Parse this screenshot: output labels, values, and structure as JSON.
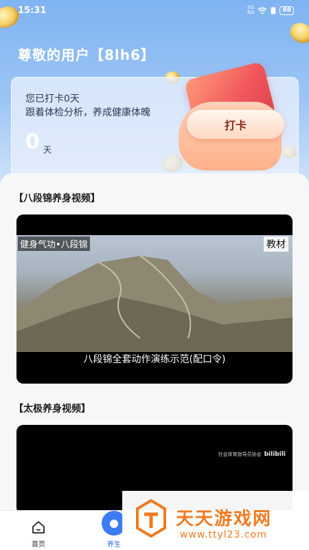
{
  "status_bar": {
    "time": "15:31",
    "signal_top": "5G",
    "signal_bottom": "8/s",
    "battery": "88"
  },
  "header": {
    "user_title": "尊敬的用户【8lh6】"
  },
  "checkin": {
    "line1": "您已打卡0天",
    "line2": "跟着体检分析，养成健康体魄",
    "days_value": "0",
    "days_unit": "天",
    "button_label": "打卡"
  },
  "sections": [
    {
      "title": "【八段锦养身视频】",
      "video": {
        "overlay_left": "健身气功•八段锦",
        "overlay_right": "教材",
        "subtitle": "八段锦全套动作演练示范(配口令)"
      }
    },
    {
      "title": "【太极养身视频】",
      "video": {
        "watermark_text": "社会体育指导员协会",
        "watermark_brand": "bilibili"
      }
    }
  ],
  "bottom_nav": {
    "items": [
      {
        "label": "首页",
        "icon": "home-icon"
      },
      {
        "label": "养生",
        "icon": "health-icon"
      }
    ]
  },
  "site_watermark": {
    "name": "天天游戏网",
    "url": "www.ttyl23.com"
  },
  "colors": {
    "accent": "#3b7cf0",
    "watermark": "#f07a1e",
    "header_top": "#7fb3f2"
  }
}
